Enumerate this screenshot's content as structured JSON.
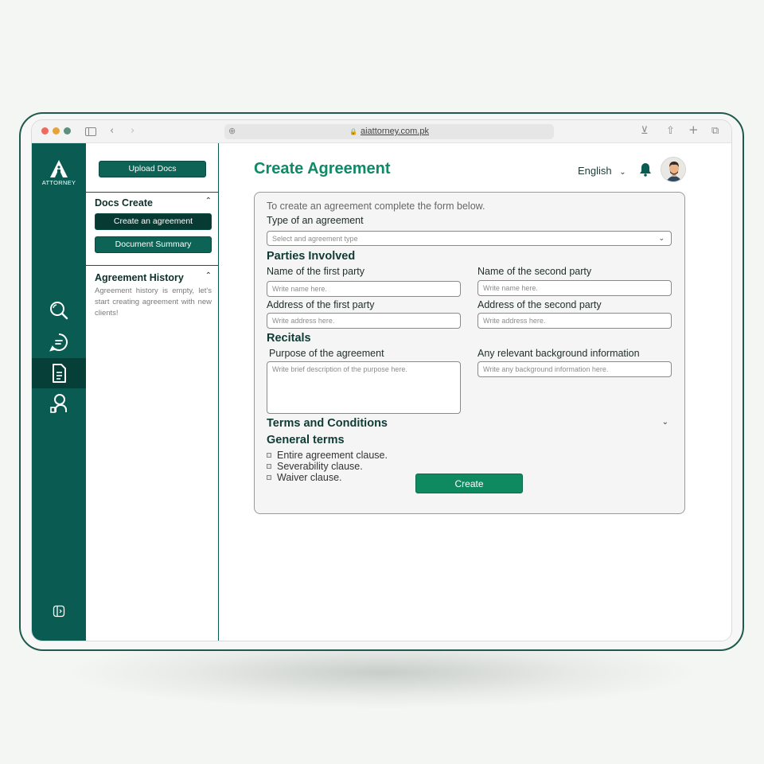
{
  "browser": {
    "url": "aiattorney.com.pk"
  },
  "brand": {
    "logo_text": "ATTORNEY",
    "primary_color": "#0a5c52",
    "accent_color": "#0f8a67"
  },
  "rail": {
    "items": [
      {
        "icon": "search-icon"
      },
      {
        "icon": "chat-icon"
      },
      {
        "icon": "document-icon",
        "active": true
      },
      {
        "icon": "user-icon"
      }
    ],
    "footer_icon": "collapse-panel-icon"
  },
  "sidebar": {
    "upload_label": "Upload Docs",
    "docs_create": {
      "title": "Docs Create",
      "items": [
        "Create an agreement",
        "Document Summary"
      ]
    },
    "history": {
      "title": "Agreement History",
      "empty_text": "Agreement history is empty, let's start creating agreement with new clients!"
    }
  },
  "header": {
    "title": "Create Agreement",
    "language": "English"
  },
  "form": {
    "intro": "To create an agreement complete the form below.",
    "type_label": "Type of an agreement",
    "type_placeholder": "Select and agreement type",
    "parties_heading": "Parties Involved",
    "first_party_name_label": "Name of the first party",
    "first_party_name_placeholder": "Write name here.",
    "second_party_name_label": "Name of the second party",
    "second_party_name_placeholder": "Write name here.",
    "first_party_address_label": "Address of the first party",
    "first_party_address_placeholder": "Write address here.",
    "second_party_address_label": "Address of the second party",
    "second_party_address_placeholder": "Write address here.",
    "recitals_heading": "Recitals",
    "purpose_label": "Purpose of the agreement",
    "purpose_placeholder": "Write brief description of the purpose here.",
    "background_label": "Any relevant background information",
    "background_placeholder": "Write any background information here.",
    "terms_heading": "Terms and Conditions",
    "general_terms_heading": "General terms",
    "general_terms": [
      "Entire agreement clause.",
      "Severability clause.",
      "Waiver clause."
    ],
    "submit_label": "Create"
  }
}
